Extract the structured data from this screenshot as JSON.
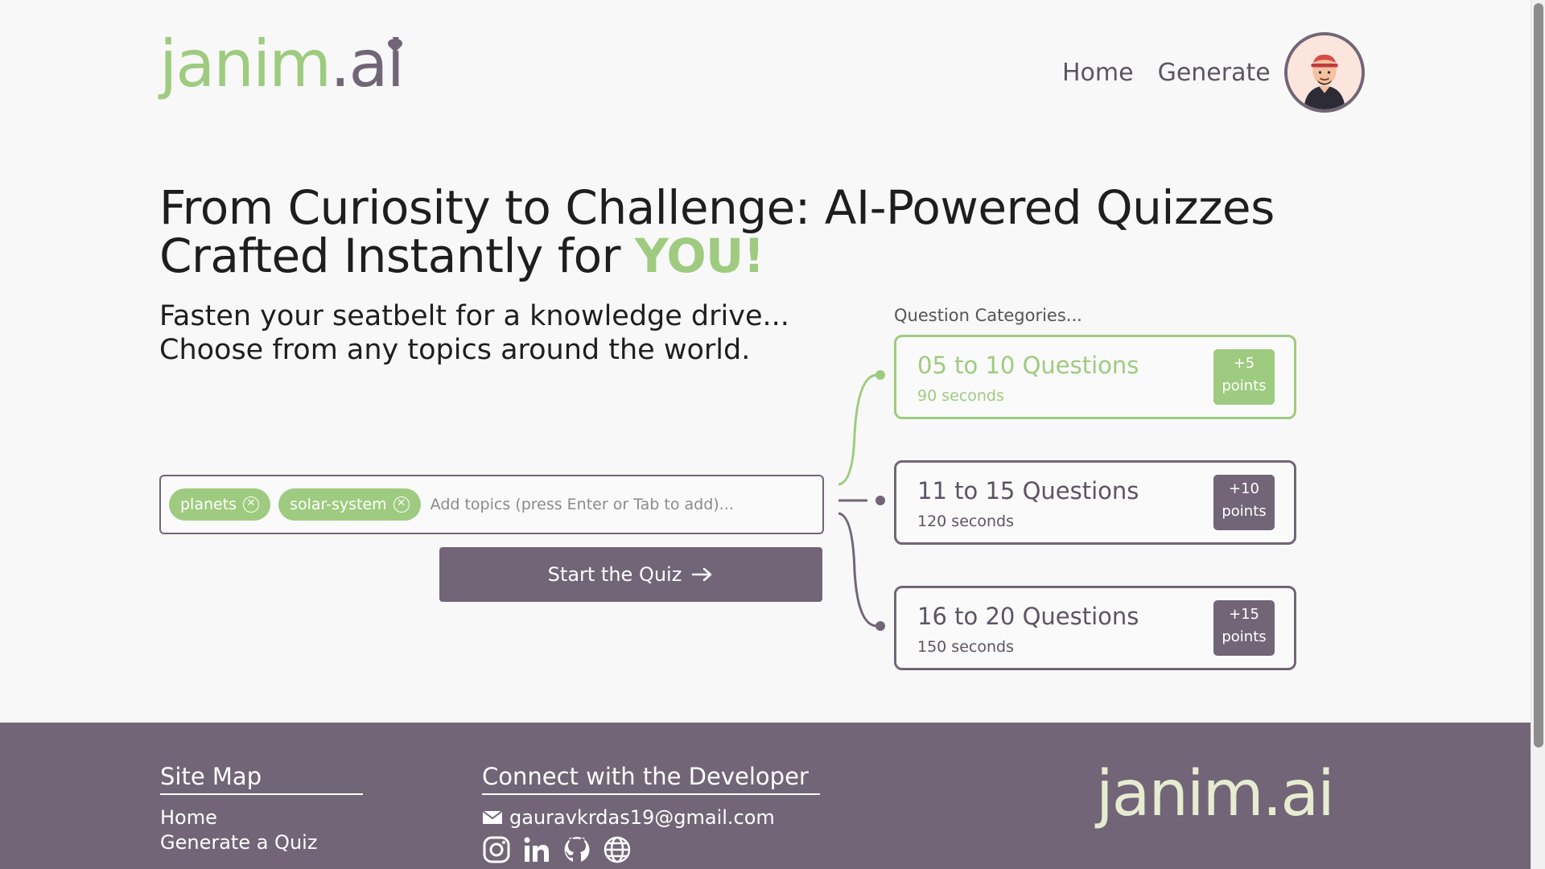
{
  "brand": {
    "logo_left": "janim",
    "logo_right": ".ai"
  },
  "nav": {
    "home": "Home",
    "generate": "Generate"
  },
  "hero": {
    "title_line1": "From Curiosity to Challenge: AI-Powered Quizzes",
    "title_line2": "Crafted Instantly for ",
    "title_highlight": "YOU!",
    "sub_line1": "Fasten your seatbelt for a knowledge drive...",
    "sub_line2": "Choose from any topics around the world."
  },
  "topics": {
    "chips": [
      "planets",
      "solar-system"
    ],
    "placeholder": "Add topics (press Enter or Tab to add)..."
  },
  "start_button": {
    "label": "Start the Quiz"
  },
  "categories": {
    "label": "Question Categories...",
    "items": [
      {
        "title": "05 to 10 Questions",
        "time": "90 seconds",
        "points": "+5",
        "points_label": "points",
        "active": true
      },
      {
        "title": "11 to 15 Questions",
        "time": "120 seconds",
        "points": "+10",
        "points_label": "points",
        "active": false
      },
      {
        "title": "16 to 20 Questions",
        "time": "150 seconds",
        "points": "+15",
        "points_label": "points",
        "active": false
      }
    ]
  },
  "footer": {
    "sitemap_heading": "Site Map",
    "sitemap_links": [
      "Home",
      "Generate a Quiz"
    ],
    "connect_heading": "Connect with the Developer",
    "email": "gauravkrdas19@gmail.com",
    "social_icons": [
      "instagram-icon",
      "linkedin-icon",
      "github-icon",
      "globe-icon"
    ],
    "logo_left": "janim",
    "logo_right": ".ai"
  },
  "colors": {
    "accent_green": "#9ecb7f",
    "accent_purple": "#726577",
    "background": "#f8f8f8"
  }
}
